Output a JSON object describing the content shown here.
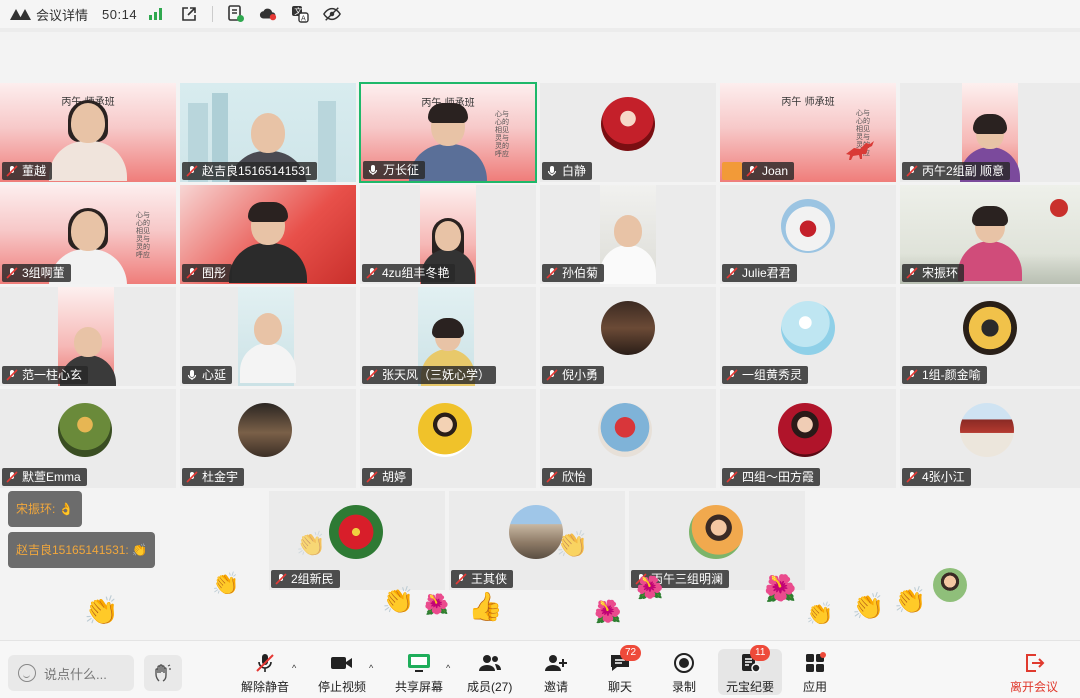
{
  "topbar": {
    "meeting_details": "会议详情",
    "duration": "50:14"
  },
  "participants": [
    {
      "name": "董越"
    },
    {
      "name": "赵吉良15165141531"
    },
    {
      "name": "万长征"
    },
    {
      "name": "白静"
    },
    {
      "name": "Joan"
    },
    {
      "name": "丙午2组副    顺意"
    },
    {
      "name": "3组啊董"
    },
    {
      "name": "囿彤"
    },
    {
      "name": "4zu组丰冬艳"
    },
    {
      "name": "孙伯菊"
    },
    {
      "name": "Julie君君"
    },
    {
      "name": "宋振环"
    },
    {
      "name": "范一柱心玄"
    },
    {
      "name": "心延"
    },
    {
      "name": "张天风（三妩心学）"
    },
    {
      "name": "倪小勇"
    },
    {
      "name": "一组黄秀灵"
    },
    {
      "name": "1组-颜金喻"
    },
    {
      "name": "默萱Emma"
    },
    {
      "name": "杜金宇"
    },
    {
      "name": "胡婷"
    },
    {
      "name": "欣怡"
    },
    {
      "name": "四组～田方霞"
    },
    {
      "name": "4张小江"
    },
    {
      "name": "2组新民"
    },
    {
      "name": "王其侠"
    },
    {
      "name": "丙午三组明澜"
    }
  ],
  "posters": {
    "title": "丙午    师承班",
    "vertical": "心与 心的相见 灵与 灵的呼应"
  },
  "chat": [
    {
      "sender": "宋振环:",
      "emoji": "👌"
    },
    {
      "sender": "赵吉良15165141531:",
      "emoji": "👏"
    }
  ],
  "toolbar": {
    "say_placeholder": "说点什么...",
    "unmute": "解除静音",
    "stop_video": "停止视频",
    "share_screen": "共享屏幕",
    "members": "成员(27)",
    "invite": "邀请",
    "chat": "聊天",
    "chat_badge": "72",
    "record": "录制",
    "minutes": "元宝纪要",
    "minutes_badge": "11",
    "apps": "应用",
    "leave": "离开会议"
  },
  "colors": {
    "active_speaker": "#1fb86a",
    "leave": "#e03a2e",
    "badge": "#ee4a3a",
    "host": "#f29a38",
    "chat_name": "#f1a73c"
  }
}
